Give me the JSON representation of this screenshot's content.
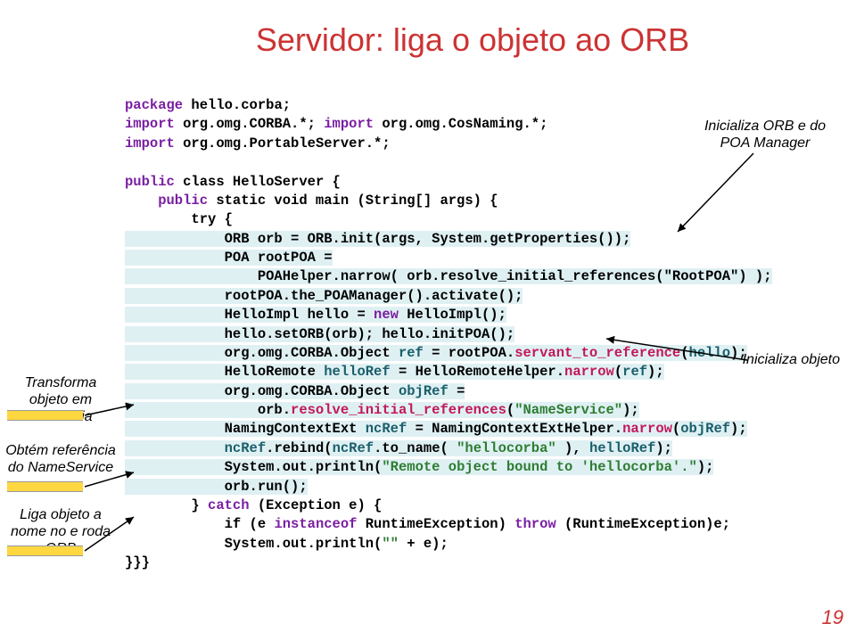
{
  "title": "Servidor: liga o objeto ao ORB",
  "code": {
    "l1a": "package",
    "l1b": " hello.corba;",
    "l2a": "import",
    "l2b": " org.omg.CORBA.*; ",
    "l2c": "import",
    "l2d": " org.omg.CosNaming.*;",
    "l3a": "import",
    "l3b": " org.omg.PortableServer.*;",
    "l4": " ",
    "l5a": "public",
    "l5b": " class HelloServer {",
    "l6a": "    public",
    "l6b": " static void main (String[] args) {",
    "l7a": "        try {",
    "l8a": "            ORB orb = ORB.init(args, System.getProperties());",
    "l9a": "            POA rootPOA =",
    "l10a": "                POAHelper.narrow( orb.resolve_initial_references(\"RootPOA\") );",
    "l11a": "            rootPOA.the_POAManager().activate();",
    "l12a": "            HelloImpl hello = ",
    "l12b": "new",
    "l12c": " HelloImpl();",
    "l13a": "            hello.setORB(orb); hello.initPOA();",
    "l14a": "            org.omg.CORBA.Object ",
    "l14b": "ref",
    "l14c": " = rootPOA.",
    "l14d": "servant_to_reference",
    "l14e": "(",
    "l14f": "hello",
    "l14g": ");",
    "l15a": "            HelloRemote ",
    "l15b": "helloRef",
    "l15c": " = HelloRemoteHelper.",
    "l15d": "narrow",
    "l15e": "(",
    "l15f": "ref",
    "l15g": ");",
    "l16a": "            org.omg.CORBA.Object ",
    "l16b": "objRef",
    "l16c": " =",
    "l17a": "                orb.",
    "l17b": "resolve_initial_references",
    "l17c": "(",
    "l17d": "\"NameService\"",
    "l17e": ");",
    "l18a": "            NamingContextExt ",
    "l18b": "ncRef",
    "l18c": " = NamingContextExtHelper.",
    "l18d": "narrow",
    "l18e": "(",
    "l18f": "objRef",
    "l18g": ");",
    "l19a": "            ",
    "l19b": "ncRef",
    "l19c": ".rebind(",
    "l19d": "ncRef",
    "l19e": ".to_name( ",
    "l19f": "\"hellocorba\"",
    "l19g": " ), ",
    "l19h": "helloRef",
    "l19i": ");",
    "l20a": "            System.out.println(",
    "l20b": "\"Remote object bound to 'hellocorba'.\"",
    "l20c": ");",
    "l21a": "            orb.run();",
    "l22a": "        } ",
    "l22b": "catch",
    "l22c": " (Exception e) {",
    "l23a": "            if (e ",
    "l23b": "instanceof",
    "l23c": " RuntimeException) ",
    "l23d": "throw",
    "l23e": " (RuntimeException)e;",
    "l24a": "            System.out.println(",
    "l24b": "\"\"",
    "l24c": " + e);",
    "l25a": "}}}"
  },
  "ann": {
    "transforma": "Transforma objeto em referência",
    "obtem": "Obtém referência do NameService",
    "liga": "Liga objeto a nome no e roda ORB",
    "initOrb": "Inicializa ORB e do POA Manager",
    "initObj": "Inicializa objeto"
  },
  "pageNum": "19"
}
